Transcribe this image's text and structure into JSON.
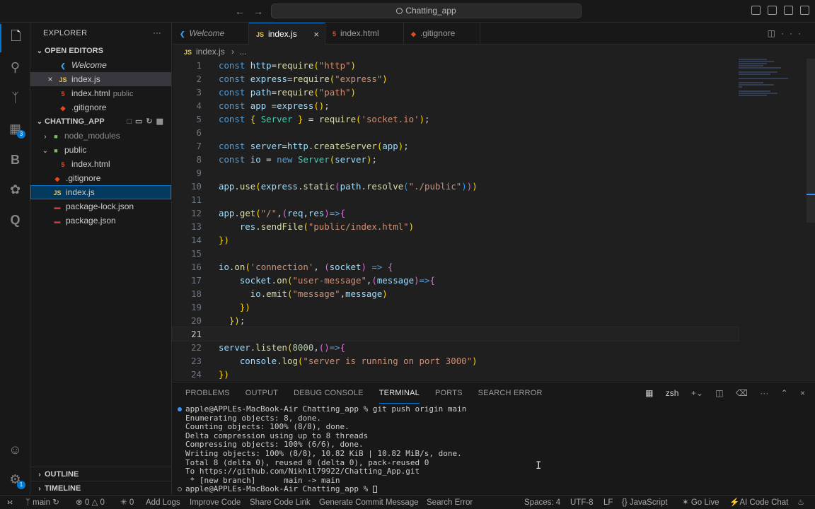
{
  "window": {
    "search_text": "Chatting_app"
  },
  "sidebar": {
    "title": "EXPLORER",
    "open_editors_title": "OPEN EDITORS",
    "open_editors": [
      {
        "name": "Welcome",
        "icon": "vscode-icon"
      },
      {
        "name": "index.js",
        "icon": "js-icon",
        "active": true
      },
      {
        "name": "index.html",
        "desc": "public",
        "icon": "html-icon"
      },
      {
        "name": ".gitignore",
        "icon": "git-icon"
      }
    ],
    "project_title": "CHATTING_APP",
    "tree": [
      {
        "name": "node_modules",
        "type": "folder"
      },
      {
        "name": "public",
        "type": "folder-open"
      },
      {
        "name": "index.html",
        "type": "html"
      },
      {
        "name": ".gitignore",
        "type": "git"
      },
      {
        "name": "index.js",
        "type": "js"
      },
      {
        "name": "package-lock.json",
        "type": "json"
      },
      {
        "name": "package.json",
        "type": "json"
      }
    ],
    "outline_title": "OUTLINE",
    "timeline_title": "TIMELINE"
  },
  "activity": {
    "extensions_badge": "3",
    "accounts_badge": "1"
  },
  "tabs": [
    {
      "label": "Welcome",
      "icon": "vscode-icon"
    },
    {
      "label": "index.js",
      "icon": "js-icon",
      "active": true
    },
    {
      "label": "index.html",
      "icon": "html-icon"
    },
    {
      "label": ".gitignore",
      "icon": "git-icon"
    }
  ],
  "breadcrumb": {
    "file": "index.js",
    "rest": "..."
  },
  "editor": {
    "current_line": 21,
    "lines": [
      "const http=require(\"http\")",
      "const express=require(\"express\")",
      "const path=require(\"path\")",
      "const app =express();",
      "const { Server } = require('socket.io');",
      "",
      "const server=http.createServer(app);",
      "const io = new Server(server);",
      "",
      "app.use(express.static(path.resolve(\"./public\")))",
      "",
      "app.get(\"/\",(req,res)=>{",
      "    res.sendFile(\"public/index.html\")",
      "})",
      "",
      "io.on('connection', (socket) => {",
      "    socket.on(\"user-message\",(message)=>{",
      "      io.emit(\"message\",message)",
      "    })",
      "  });",
      "",
      "server.listen(8000,()=>{",
      "    console.log(\"server is running on port 3000\")",
      "})"
    ]
  },
  "panel": {
    "tabs": [
      "PROBLEMS",
      "OUTPUT",
      "DEBUG CONSOLE",
      "TERMINAL",
      "PORTS",
      "SEARCH ERROR"
    ],
    "active_tab": "TERMINAL",
    "shell": "zsh",
    "terminal_lines": [
      "apple@APPLEs-MacBook-Air Chatting_app % git push origin main",
      "Enumerating objects: 8, done.",
      "Counting objects: 100% (8/8), done.",
      "Delta compression using up to 8 threads",
      "Compressing objects: 100% (6/6), done.",
      "Writing objects: 100% (8/8), 10.82 KiB | 10.82 MiB/s, done.",
      "Total 8 (delta 0), reused 0 (delta 0), pack-reused 0",
      "To https://github.com/Nikhil79922/Chatting_App.git",
      " * [new branch]      main -> main",
      "apple@APPLEs-MacBook-Air Chatting_app % "
    ]
  },
  "status": {
    "branch": "main",
    "errors": "0",
    "warnings": "0",
    "ports": "0",
    "left_items": [
      "Add Logs",
      "Improve Code",
      "Share Code Link",
      "Generate Commit Message",
      "Search Error"
    ],
    "spaces": "Spaces: 4",
    "encoding": "UTF-8",
    "eol": "LF",
    "language": "JavaScript",
    "golive": "Go Live",
    "ai": "AI Code Chat"
  },
  "colors": {
    "accent": "#0078d4",
    "editor_bg": "#1f1f1f",
    "sidebar_bg": "#181818"
  }
}
